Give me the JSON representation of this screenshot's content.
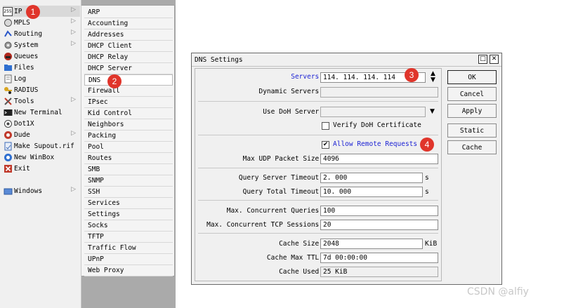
{
  "sidebar": {
    "items": [
      {
        "label": "IP",
        "icon": "ip-icon",
        "arrow": "▷"
      },
      {
        "label": "MPLS",
        "icon": "mpls-icon",
        "arrow": "▷"
      },
      {
        "label": "Routing",
        "icon": "routing-icon",
        "arrow": "▷"
      },
      {
        "label": "System",
        "icon": "gear-icon",
        "arrow": "▷"
      },
      {
        "label": "Queues",
        "icon": "queues-icon",
        "arrow": ""
      },
      {
        "label": "Files",
        "icon": "folder-icon",
        "arrow": ""
      },
      {
        "label": "Log",
        "icon": "log-icon",
        "arrow": ""
      },
      {
        "label": "RADIUS",
        "icon": "radius-icon",
        "arrow": ""
      },
      {
        "label": "Tools",
        "icon": "tools-icon",
        "arrow": "▷"
      },
      {
        "label": "New Terminal",
        "icon": "terminal-icon",
        "arrow": ""
      },
      {
        "label": "Dot1X",
        "icon": "dot1x-icon",
        "arrow": ""
      },
      {
        "label": "Dude",
        "icon": "dude-icon",
        "arrow": "▷"
      },
      {
        "label": "Make Supout.rif",
        "icon": "supout-icon",
        "arrow": ""
      },
      {
        "label": "New WinBox",
        "icon": "winbox-icon",
        "arrow": ""
      },
      {
        "label": "Exit",
        "icon": "exit-icon",
        "arrow": ""
      },
      {
        "label": "Windows",
        "icon": "windows-icon",
        "arrow": "▷"
      }
    ]
  },
  "submenu": {
    "items": [
      "ARP",
      "Accounting",
      "Addresses",
      "DHCP Client",
      "DHCP Relay",
      "DHCP Server",
      "DNS",
      "Firewall",
      "IPsec",
      "Kid Control",
      "Neighbors",
      "Packing",
      "Pool",
      "Routes",
      "SMB",
      "SNMP",
      "SSH",
      "Services",
      "Settings",
      "Socks",
      "TFTP",
      "Traffic Flow",
      "UPnP",
      "Web Proxy"
    ]
  },
  "badges": [
    "1",
    "2",
    "3",
    "4"
  ],
  "dialog": {
    "title": "DNS Settings",
    "restore_glyph": "□",
    "close_glyph": "✕",
    "servers_label": "Servers:",
    "servers_value": "114. 114. 114. 114",
    "dynamic_servers_label": "Dynamic Servers:",
    "dynamic_servers_value": "",
    "use_doh_label": "Use DoH Server:",
    "use_doh_value": "",
    "verify_doh_label": "Verify DoH Certificate",
    "verify_doh_checked": false,
    "allow_remote_label": "Allow Remote Requests",
    "allow_remote_checked": true,
    "check_glyph": "✔",
    "max_udp_label": "Max UDP Packet Size:",
    "max_udp_value": "4096",
    "query_server_timeout_label": "Query Server Timeout:",
    "query_server_timeout_value": "2. 000",
    "query_total_timeout_label": "Query Total Timeout:",
    "query_total_timeout_value": "10. 000",
    "timeout_unit": "s",
    "max_concurrent_queries_label": "Max. Concurrent Queries:",
    "max_concurrent_queries_value": "100",
    "max_concurrent_tcp_label": "Max. Concurrent TCP Sessions:",
    "max_concurrent_tcp_value": "20",
    "cache_size_label": "Cache Size:",
    "cache_size_value": "2048",
    "cache_size_unit": "KiB",
    "cache_max_ttl_label": "Cache Max TTL:",
    "cache_max_ttl_value": "7d 00:00:00",
    "cache_used_label": "Cache Used:",
    "cache_used_value": "25 KiB",
    "buttons": {
      "ok": "OK",
      "cancel": "Cancel",
      "apply": "Apply",
      "static": "Static",
      "cache": "Cache"
    },
    "arrow_up": "▲",
    "arrow_down": "▼"
  },
  "watermark": "CSDN @alfiy"
}
